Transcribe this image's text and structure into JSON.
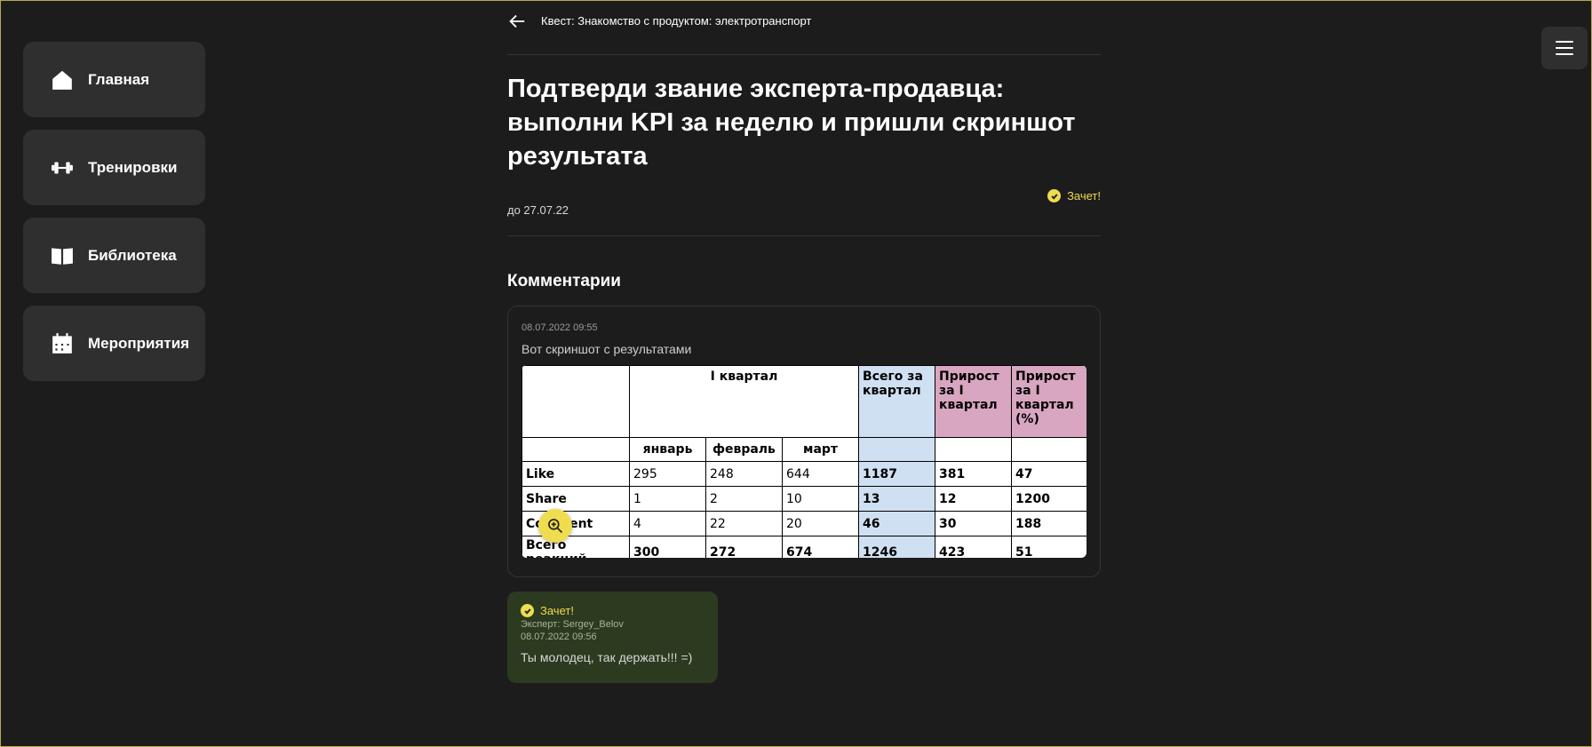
{
  "sidebar": {
    "items": [
      {
        "label": "Главная",
        "icon": "home-icon"
      },
      {
        "label": "Тренировки",
        "icon": "dumbbell-icon"
      },
      {
        "label": "Библиотека",
        "icon": "book-icon"
      },
      {
        "label": "Мероприятия",
        "icon": "calendar-icon"
      }
    ]
  },
  "header": {
    "breadcrumb": "Квест: Знакомство с продуктом: электротранспорт",
    "title": "Подтверди звание эксперта-продавца: выполни KPI за неделю и пришли скриншот результата",
    "deadline": "до 27.07.22",
    "status": "Зачет!"
  },
  "comments": {
    "section_title": "Комментарии",
    "item": {
      "date": "08.07.2022 09:55",
      "text": "Вот скриншот с результатами"
    }
  },
  "kpi_table": {
    "header": {
      "quarter": "I квартал",
      "total": "Всего за квартал",
      "growth": "Прирост за I квартал",
      "growth_pct": "Прирост за I квартал (%)"
    },
    "months": [
      "январь",
      "февраль",
      "март"
    ],
    "rows": [
      {
        "name": "Like",
        "jan": "295",
        "feb": "248",
        "mar": "644",
        "total": "1187",
        "growth": "381",
        "pct": "47"
      },
      {
        "name": "Share",
        "jan": "1",
        "feb": "2",
        "mar": "10",
        "total": "13",
        "growth": "12",
        "pct": "1200"
      },
      {
        "name": "Comment",
        "jan": "4",
        "feb": "22",
        "mar": "20",
        "total": "46",
        "growth": "30",
        "pct": "188"
      },
      {
        "name": "Всего реакций",
        "jan": "300",
        "feb": "272",
        "mar": "674",
        "total": "1246",
        "growth": "423",
        "pct": "51"
      }
    ]
  },
  "review": {
    "status": "Зачет!",
    "expert": "Эксперт: Sergey_Belov",
    "date": "08.07.2022 09:56",
    "text": "Ты молодец, так держать!!! =)"
  },
  "colors": {
    "accent": "#f0dc4f",
    "background": "#1c1c1c",
    "card": "#2f2f2f",
    "review_bg": "#2c3a20"
  }
}
